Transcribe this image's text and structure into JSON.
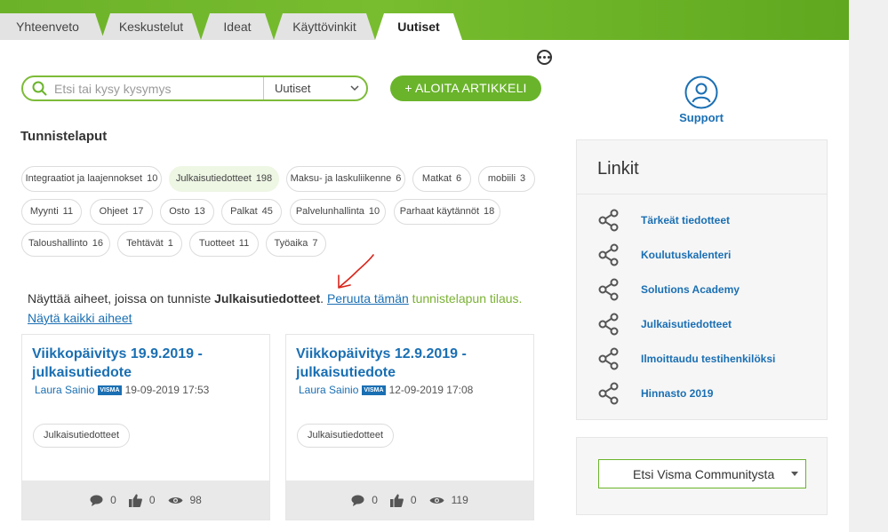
{
  "tabs": [
    {
      "label": "Yhteenveto"
    },
    {
      "label": "Keskustelut"
    },
    {
      "label": "Ideat"
    },
    {
      "label": "Käyttövinkit"
    },
    {
      "label": "Uutiset"
    }
  ],
  "search": {
    "placeholder": "Etsi tai kysy kysymys",
    "scope": "Uutiset"
  },
  "start_button": {
    "label": "+ ALOITA ARTIKKELI"
  },
  "support": {
    "label": "Support"
  },
  "tags": {
    "heading": "Tunnistelaput",
    "items": [
      {
        "name": "Integraatiot ja laajennokset",
        "count": "10"
      },
      {
        "name": "Julkaisutiedotteet",
        "count": "198"
      },
      {
        "name": "Maksu- ja laskuliikenne",
        "count": "6"
      },
      {
        "name": "Matkat",
        "count": "6"
      },
      {
        "name": "mobiili",
        "count": "3"
      },
      {
        "name": "Myynti",
        "count": "11"
      },
      {
        "name": "Ohjeet",
        "count": "17"
      },
      {
        "name": "Osto",
        "count": "13"
      },
      {
        "name": "Palkat",
        "count": "45"
      },
      {
        "name": "Palvelunhallinta",
        "count": "10"
      },
      {
        "name": "Parhaat käytännöt",
        "count": "18"
      },
      {
        "name": "Taloushallinto",
        "count": "16"
      },
      {
        "name": "Tehtävät",
        "count": "1"
      },
      {
        "name": "Tuotteet",
        "count": "11"
      },
      {
        "name": "Työaika",
        "count": "7"
      }
    ]
  },
  "filter": {
    "prefix": "Näyttää aiheet, joissa on tunniste ",
    "tag": "Julkaisutiedotteet",
    "period": ". ",
    "unsubscribe_link": "Peruuta tämän",
    "unsubscribe_rest": " tunnistelapun tilaus. ",
    "show_all_link": "Näytä kaikki aiheet"
  },
  "posts": [
    {
      "title": "Viikkopäivitys 19.9.2019 - julkaisutiedote",
      "author": "Laura Sainio",
      "badge": "VISMA",
      "date": "19-09-2019 17:53",
      "tag": "Julkaisutiedotteet",
      "comments": "0",
      "likes": "0",
      "views": "98"
    },
    {
      "title": "Viikkopäivitys 12.9.2019 - julkaisutiedote",
      "author": "Laura Sainio",
      "badge": "VISMA",
      "date": "12-09-2019 17:08",
      "tag": "Julkaisutiedotteet",
      "comments": "0",
      "likes": "0",
      "views": "119"
    }
  ],
  "links": {
    "title": "Linkit",
    "items": [
      {
        "label": "Tärkeät tiedotteet"
      },
      {
        "label": "Koulutuskalenteri"
      },
      {
        "label": "Solutions Academy"
      },
      {
        "label": "Julkaisutiedotteet"
      },
      {
        "label": "Ilmoittaudu testihenkilöksi"
      },
      {
        "label": "Hinnasto 2019"
      }
    ]
  },
  "community": {
    "select_label": "Etsi Visma Communitysta"
  },
  "colors": {
    "brand_green": "#6ab42b",
    "link_blue": "#1a6fb3",
    "arrow_red": "#d9261c"
  }
}
